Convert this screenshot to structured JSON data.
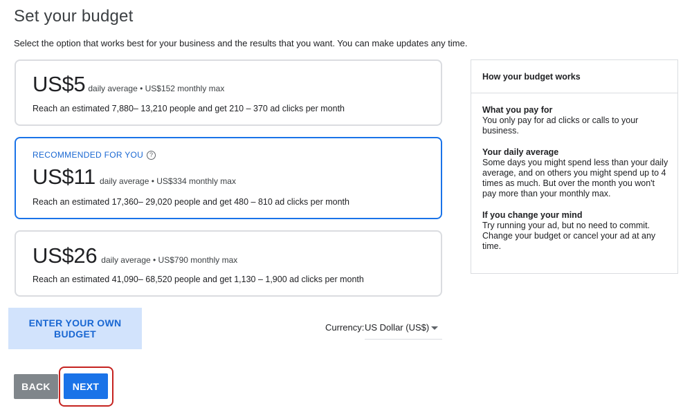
{
  "page": {
    "title": "Set your budget",
    "subtitle": "Select the option that works best for your business and the results that you want. You can make updates any time."
  },
  "options": [
    {
      "amount": "US$5",
      "meta": "daily average • US$152 monthly max",
      "reach": "Reach an estimated 7,880– 13,210 people and get 210 – 370 ad clicks per month",
      "selected": false
    },
    {
      "recommended_label": "RECOMMENDED FOR YOU",
      "help_icon": "?",
      "amount": "US$11",
      "meta": "daily average • US$334 monthly max",
      "reach": "Reach an estimated 17,360– 29,020 people and get 480 – 810 ad clicks per month",
      "selected": true
    },
    {
      "amount": "US$26",
      "meta": "daily average • US$790 monthly max",
      "reach": "Reach an estimated 41,090– 68,520 people and get 1,130 – 1,900 ad clicks per month",
      "selected": false
    }
  ],
  "own_budget_label": "ENTER YOUR OWN BUDGET",
  "currency": {
    "label": "Currency:",
    "value": "US Dollar (US$)",
    "icon": "caret-down-icon"
  },
  "side_panel": {
    "header": "How your budget works",
    "sections": [
      {
        "title": "What you pay for",
        "text": "You only pay for ad clicks or calls to your business."
      },
      {
        "title": "Your daily average",
        "text": "Some days you might spend less than your daily average, and on others you might spend up to 4 times as much. But over the month you won't pay more than your monthly max."
      },
      {
        "title": "If you change your mind",
        "text": "Try running your ad, but no need to commit. Change your budget or cancel your ad at any time."
      }
    ]
  },
  "buttons": {
    "back": "BACK",
    "next": "NEXT"
  },
  "colors": {
    "accent": "#1a73e8",
    "highlight": "#c5221f",
    "own_budget_bg": "#d2e3fc"
  }
}
